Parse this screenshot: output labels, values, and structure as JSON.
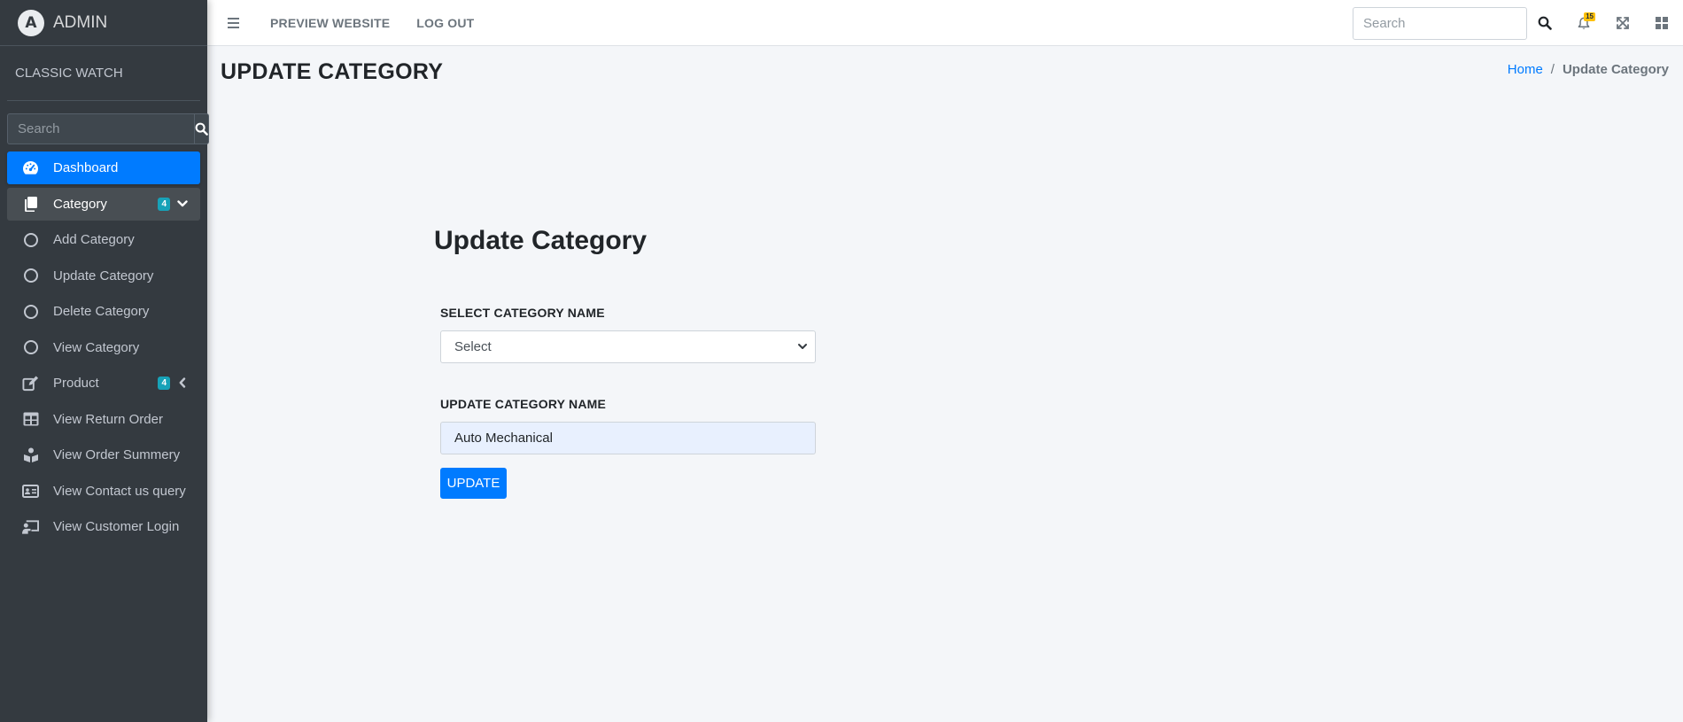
{
  "brand": {
    "name": "ADMIN",
    "logo_letter": "A"
  },
  "user": {
    "name": "CLASSIC WATCH"
  },
  "sidebar": {
    "search_placeholder": "Search",
    "items": [
      {
        "label": "Dashboard",
        "icon": "tachometer-icon"
      },
      {
        "label": "Category",
        "icon": "copy-icon",
        "badge": "4"
      },
      {
        "label": "Add Category",
        "icon": "circle-icon"
      },
      {
        "label": "Update Category",
        "icon": "circle-icon"
      },
      {
        "label": "Delete Category",
        "icon": "circle-icon"
      },
      {
        "label": "View Category",
        "icon": "circle-icon"
      },
      {
        "label": "Product",
        "icon": "edit-icon",
        "badge": "4"
      },
      {
        "label": "View Return Order",
        "icon": "table-icon"
      },
      {
        "label": "View Order Summery",
        "icon": "book-reader-icon"
      },
      {
        "label": "View Contact us query",
        "icon": "address-card-icon"
      },
      {
        "label": "View Customer Login",
        "icon": "chalkboard-teacher-icon"
      }
    ]
  },
  "topbar": {
    "links": [
      "PREVIEW WEBSITE",
      "LOG OUT"
    ],
    "search_placeholder": "Search",
    "notification_count": "15"
  },
  "page": {
    "title": "UPDATE CATEGORY",
    "breadcrumb": [
      "Home",
      "Update Category"
    ]
  },
  "form": {
    "heading": "Update Category",
    "select_label": "SELECT CATEGORY NAME",
    "select_value": "Select",
    "name_label": "UPDATE CATEGORY NAME",
    "name_value": "Auto Mechanical",
    "submit_label": "UPDATE"
  },
  "colors": {
    "sidebar_bg": "#343a40",
    "primary": "#007bff",
    "badge_info": "#17a2b8",
    "badge_warning": "#ffc107",
    "content_bg": "#f4f6f9"
  }
}
